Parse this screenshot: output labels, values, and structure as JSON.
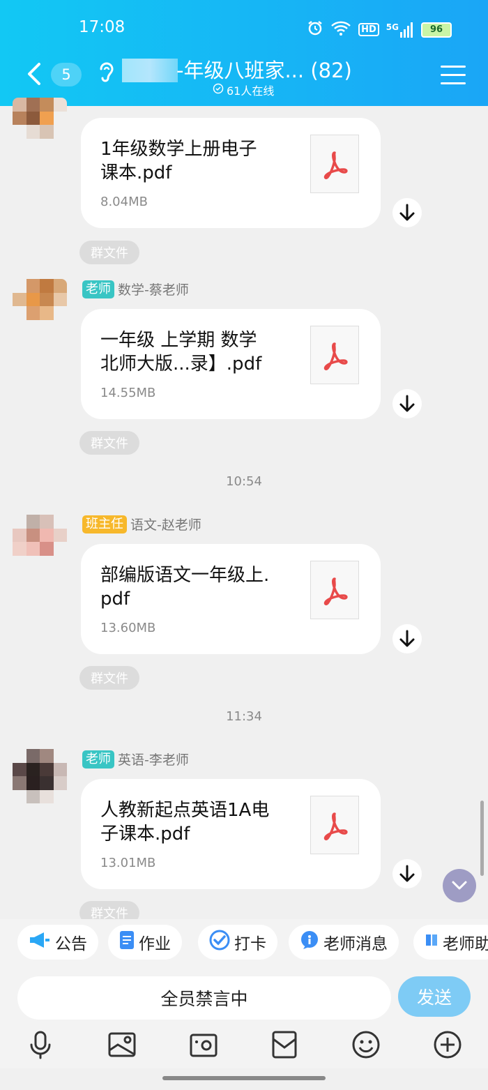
{
  "status": {
    "time": "17:08",
    "battery": "96",
    "network": "5G",
    "hd": "HD"
  },
  "header": {
    "unread_count": "5",
    "title": "-年级八班家... (82)",
    "online": "61人在线"
  },
  "messages": [
    {
      "role": "",
      "sender": "",
      "file_name": "1年级数学上册电子课本.pdf",
      "file_name_l1": "1年级数学上册电子",
      "file_name_l2": "课本.pdf",
      "size": "8.04MB",
      "tag": "群文件"
    },
    {
      "role": "老师",
      "sender": "数学-蔡老师",
      "file_name_l1": "一年级 上学期 数学",
      "file_name_l2": "北师大版...录】.pdf",
      "size": "14.55MB",
      "tag": "群文件"
    },
    {
      "role": "班主任",
      "sender": "语文-赵老师",
      "file_name_l1": "部编版语文一年级上.",
      "file_name_l2": "pdf",
      "size": "13.60MB",
      "tag": "群文件"
    },
    {
      "role": "老师",
      "sender": "英语-李老师",
      "file_name_l1": "人教新起点英语1A电",
      "file_name_l2": "子课本.pdf",
      "size": "13.01MB",
      "tag": "群文件"
    }
  ],
  "timestamps": [
    "10:54",
    "11:34"
  ],
  "toolbar": {
    "items": [
      "公告",
      "作业",
      "打卡",
      "老师消息",
      "老师助"
    ]
  },
  "input": {
    "muted_text": "全员禁言中",
    "send_label": "发送"
  },
  "colors": {
    "header": "#1ab4f5",
    "teacher_badge": "#39c5c4",
    "head_badge": "#f7b82b",
    "pdf_red": "#e84a4a"
  }
}
